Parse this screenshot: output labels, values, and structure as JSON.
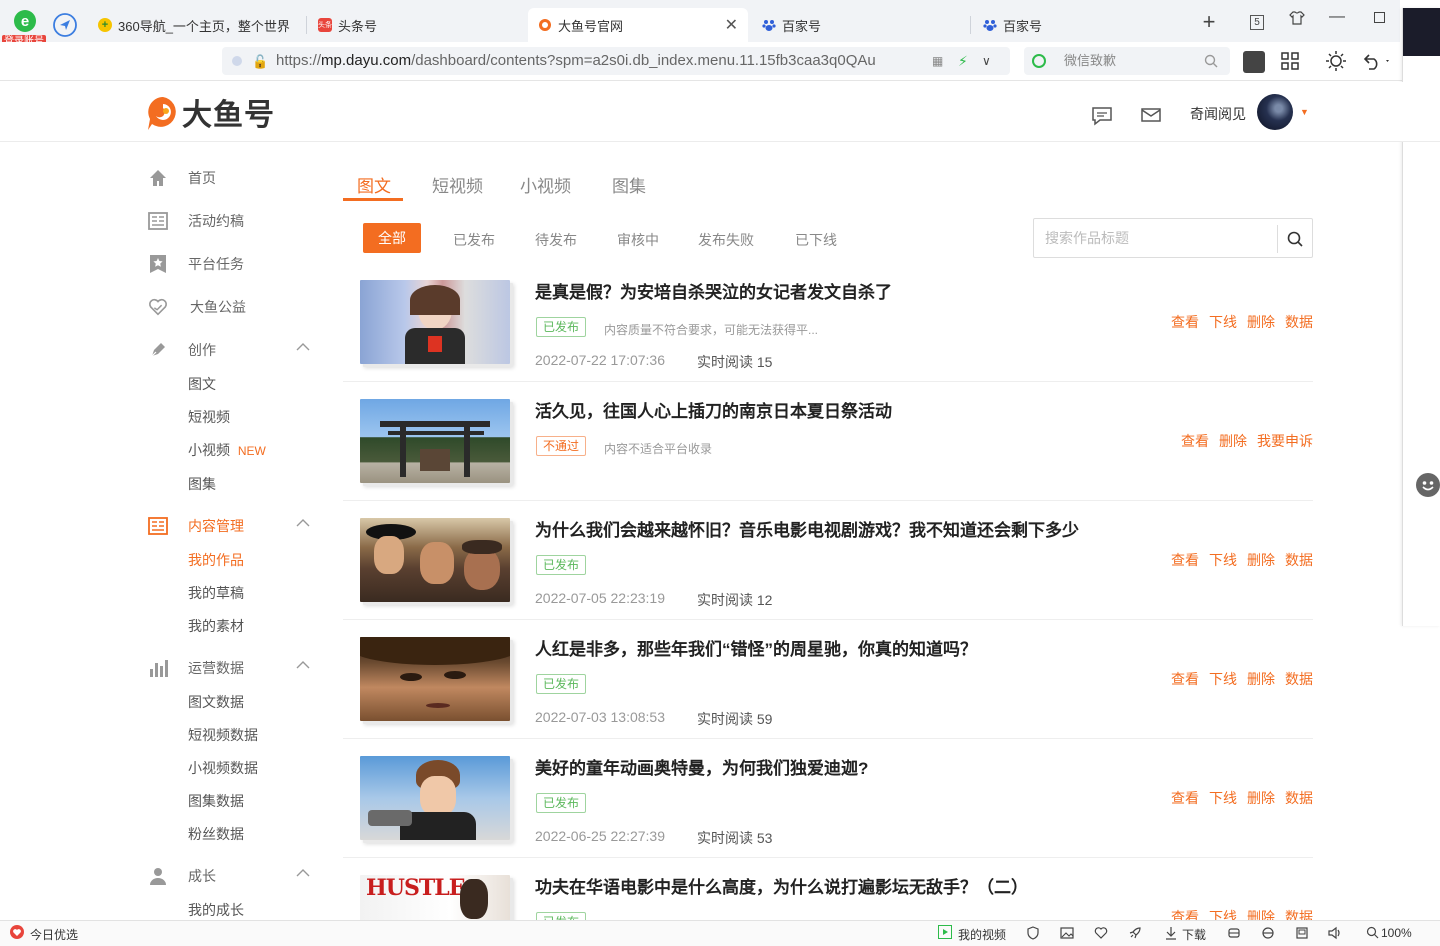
{
  "browser": {
    "login_badge": "登录账号",
    "tabs": [
      {
        "title": "360导航_一个主页，整个世界"
      },
      {
        "title": "头条号"
      },
      {
        "title": "大鱼号官网"
      },
      {
        "title": "百家号"
      },
      {
        "title": "百家号"
      }
    ],
    "tab_fav_text": "头条",
    "tab_count": "5",
    "url_prefix": "https://",
    "url_host": "mp.dayu.com",
    "url_path": "/dashboard/contents?spm=a2s0i.db_index.menu.11.15fb3caa3q0QAu",
    "search_placeholder": "微信致歉"
  },
  "site": {
    "logo_text": "大鱼号",
    "username": "奇闻阅见"
  },
  "sidebar": {
    "groups": [
      {
        "label": "首页"
      },
      {
        "label": "活动约稿"
      },
      {
        "label": "平台任务"
      },
      {
        "label": "大鱼公益"
      },
      {
        "label": "创作"
      },
      {
        "label": "内容管理"
      },
      {
        "label": "运营数据"
      },
      {
        "label": "成长"
      }
    ],
    "create_items": [
      "图文",
      "短视频",
      "小视频",
      "图集"
    ],
    "new_tag": "NEW",
    "content_items": [
      "我的作品",
      "我的草稿",
      "我的素材"
    ],
    "data_items": [
      "图文数据",
      "短视频数据",
      "小视频数据",
      "图集数据",
      "粉丝数据"
    ],
    "growth_items": [
      "我的成长"
    ]
  },
  "content_tabs": [
    "图文",
    "短视频",
    "小视频",
    "图集"
  ],
  "filters": [
    "全部",
    "已发布",
    "待发布",
    "审核中",
    "发布失败",
    "已下线"
  ],
  "search": {
    "placeholder": "搜索作品标题"
  },
  "articles": [
    {
      "title": "是真是假？为安培自杀哭泣的女记者发文自杀了",
      "status": "已发布",
      "note": "内容质量不符合要求，可能无法获得平...",
      "date": "2022-07-22 17:07:36",
      "reads": "实时阅读 15",
      "actions": [
        "查看",
        "下线",
        "删除",
        "数据"
      ]
    },
    {
      "title": "活久见，往国人心上插刀的南京日本夏日祭活动",
      "status": "不通过",
      "note": "内容不适合平台收录",
      "date": "",
      "reads": "",
      "actions": [
        "查看",
        "删除",
        "我要申诉"
      ]
    },
    {
      "title": "为什么我们会越来越怀旧？音乐电影电视剧游戏？我不知道还会剩下多少",
      "status": "已发布",
      "note": "",
      "date": "2022-07-05 22:23:19",
      "reads": "实时阅读 12",
      "actions": [
        "查看",
        "下线",
        "删除",
        "数据"
      ]
    },
    {
      "title": "人红是非多，那些年我们“错怪”的周星驰，你真的知道吗？",
      "status": "已发布",
      "note": "",
      "date": "2022-07-03 13:08:53",
      "reads": "实时阅读 59",
      "actions": [
        "查看",
        "下线",
        "删除",
        "数据"
      ]
    },
    {
      "title": "美好的童年动画奥特曼，为何我们独爱迪迦?",
      "status": "已发布",
      "note": "",
      "date": "2022-06-25 22:27:39",
      "reads": "实时阅读 53",
      "actions": [
        "查看",
        "下线",
        "删除",
        "数据"
      ]
    },
    {
      "title": "功夫在华语电影中是什么高度，为什么说打遍影坛无敌手？（二）",
      "status": "已发布",
      "note": "",
      "date": "",
      "reads": "",
      "actions": [
        "查看",
        "下线",
        "删除",
        "数据"
      ]
    }
  ],
  "thumb_text": "HUSTLE",
  "statusbar": {
    "left": "今日优选",
    "video": "我的视频",
    "download": "下载",
    "zoom": "100%"
  }
}
